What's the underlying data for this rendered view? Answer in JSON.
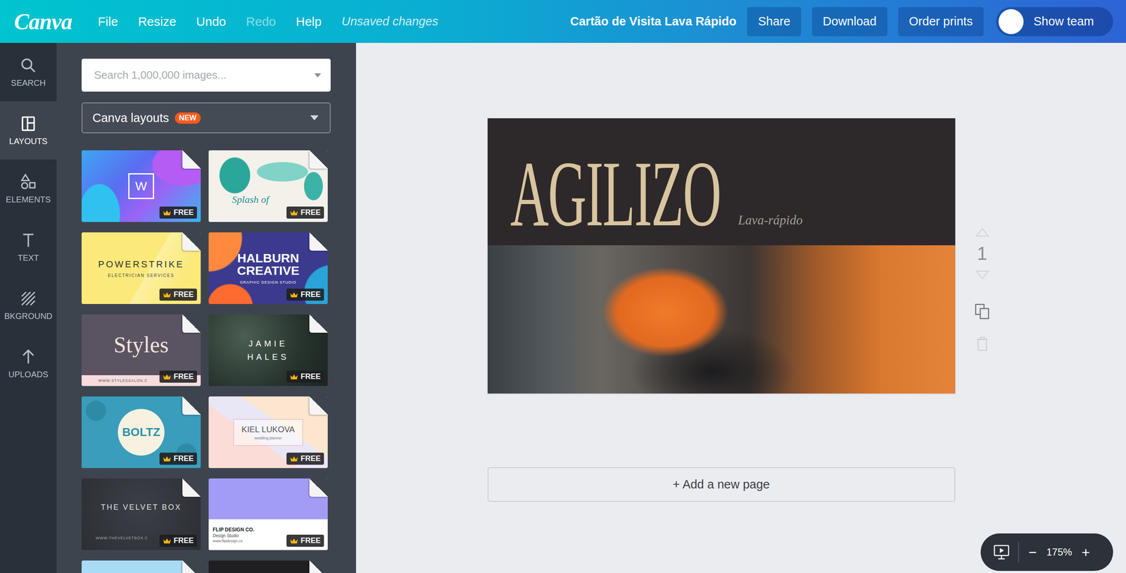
{
  "topbar": {
    "logo": "Canva",
    "menu": [
      {
        "label": "File",
        "disabled": false
      },
      {
        "label": "Resize",
        "disabled": false
      },
      {
        "label": "Undo",
        "disabled": false
      },
      {
        "label": "Redo",
        "disabled": true
      },
      {
        "label": "Help",
        "disabled": false
      }
    ],
    "status": "Unsaved changes",
    "title": "Cartão de Visita Lava Rápido",
    "buttons": [
      "Share",
      "Download",
      "Order prints"
    ],
    "team": {
      "label": "Show team",
      "on": false
    }
  },
  "rail": [
    {
      "label": "SEARCH",
      "selected": false
    },
    {
      "label": "LAYOUTS",
      "selected": true
    },
    {
      "label": "ELEMENTS",
      "selected": false
    },
    {
      "label": "TEXT",
      "selected": false
    },
    {
      "label": "BKGROUND",
      "selected": false
    },
    {
      "label": "UPLOADS",
      "selected": false
    }
  ],
  "panel": {
    "search": {
      "placeholder": "Search 1,000,000 images..."
    },
    "source": {
      "label": "Canva layouts",
      "badge": "NEW"
    },
    "layouts": [
      {
        "texts": [
          "W"
        ],
        "badge": "FREE"
      },
      {
        "texts": [
          "Splash of"
        ],
        "badge": "FREE"
      },
      {
        "texts": [
          "POWERSTRIKE",
          "ELECTRICIAN SERVICES"
        ],
        "badge": "FREE"
      },
      {
        "texts": [
          "HALBURN CREATIVE",
          "GRAPHIC DESIGN STUDIO"
        ],
        "badge": "FREE"
      },
      {
        "texts": [
          "Styles",
          "WWW.STYLESSALON.C"
        ],
        "badge": "FREE"
      },
      {
        "texts": [
          "JAMIE HALES"
        ],
        "badge": "FREE"
      },
      {
        "texts": [
          "BOLTZ"
        ],
        "badge": "FREE"
      },
      {
        "texts": [
          "KIEL LUKOVA",
          "wedding planner"
        ],
        "badge": "FREE"
      },
      {
        "texts": [
          "THE VELVET BOX",
          "WWW.THEVELVETBOX.C"
        ],
        "badge": "FREE"
      },
      {
        "texts": [
          "FLIP DESIGN CO.",
          "Design Studio",
          "www.flipdesign.co"
        ],
        "badge": "FREE"
      },
      {
        "texts": []
      },
      {
        "texts": []
      }
    ]
  },
  "design": {
    "brand": "AGILIZO",
    "tagline": "Lava-rápido"
  },
  "page": {
    "number": "1",
    "up_disabled": true,
    "down_disabled": true,
    "delete_disabled": true
  },
  "add_page": "+ Add a new page",
  "zoom": {
    "minus": "−",
    "value": "175%",
    "plus": "+"
  }
}
